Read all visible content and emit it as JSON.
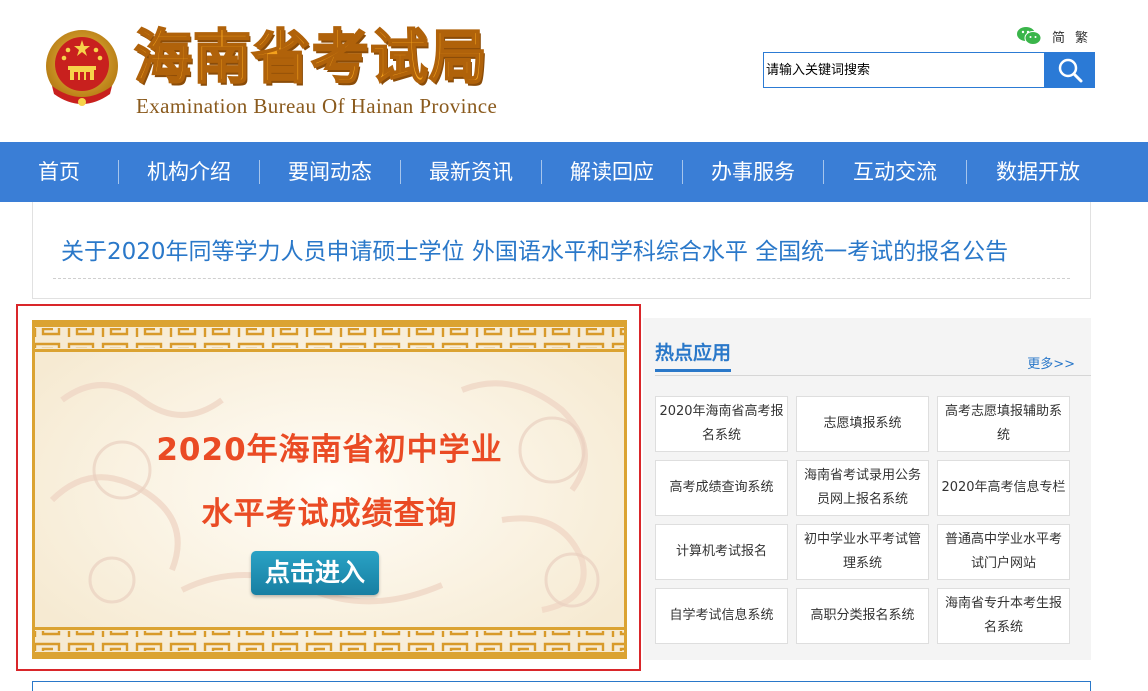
{
  "header": {
    "logo_cn": "海南省考试局",
    "logo_en": "Examination Bureau Of Hainan Province",
    "lang_simplified": "简",
    "lang_traditional": "繁",
    "search_placeholder": "请输入关键词搜索"
  },
  "nav": {
    "items": [
      "首页",
      "机构介绍",
      "要闻动态",
      "最新资讯",
      "解读回应",
      "办事服务",
      "互动交流",
      "数据开放"
    ]
  },
  "notice": {
    "headline": "关于2020年同等学力人员申请硕士学位  外国语水平和学科综合水平  全国统一考试的报名公告"
  },
  "promo": {
    "line1": "2020年海南省初中学业",
    "line2": "水平考试成绩查询",
    "button": "点击进入"
  },
  "hot_apps": {
    "title": "热点应用",
    "more": "更多>>",
    "items": [
      "2020年海南省高考报名系统",
      "志愿填报系统",
      "高考志愿填报辅助系统",
      "高考成绩查询系统",
      "海南省考试录用公务员网上报名系统",
      "2020年高考信息专栏",
      "计算机考试报名",
      "初中学业水平考试管理系统",
      "普通高中学业水平考试门户网站",
      "自学考试信息系统",
      "高职分类报名系统",
      "海南省专升本考生报名系统"
    ]
  },
  "colors": {
    "nav_bg": "#3a7ed6",
    "link_blue": "#2a78c9",
    "logo_orange": "#f3a11d",
    "promo_red": "#ea4b24",
    "frame_red": "#d9262a"
  },
  "icons": [
    "national-emblem-icon",
    "wechat-icon",
    "search-icon"
  ]
}
